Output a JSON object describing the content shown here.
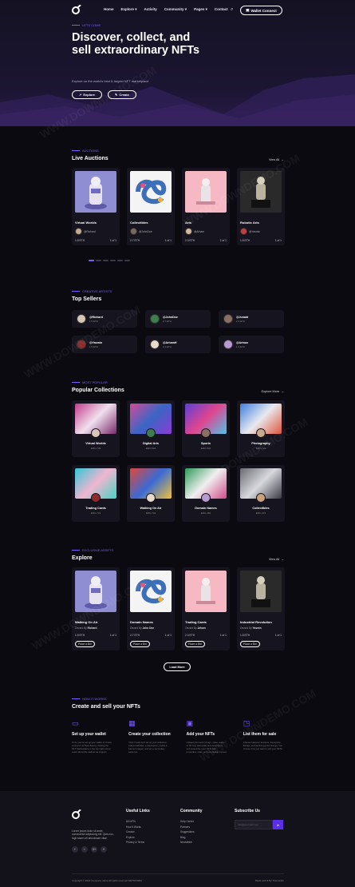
{
  "nav": {
    "items": [
      "Home",
      "Explore ▾",
      "Activity",
      "Community ▾",
      "Pages ▾",
      "Contact"
    ],
    "wallet_label": "Wallet Connect"
  },
  "hero": {
    "eyebrow": "LETS COME",
    "title": "Discover, collect, and sell extraordinary NFTs",
    "subtitle": "Explore on the world's best & largest NFT marketplace",
    "explore_label": "Explore",
    "create_label": "Create"
  },
  "auctions": {
    "eyebrow": "AUCTIONS",
    "title": "Live Auctions",
    "view_all": "View All",
    "items": [
      {
        "name": "Virtual Worlds",
        "owner": "@Richard",
        "price": "1.5 ETH",
        "count": "1 of 1"
      },
      {
        "name": "Collectibles",
        "owner": "@JohnDoe",
        "price": "2.7 ETH",
        "count": "1 of 1"
      },
      {
        "name": "Arts",
        "owner": "@Arham",
        "price": "2.3 ETH",
        "count": "1 of 1"
      },
      {
        "name": "Robotic Arts",
        "owner": "@Yasmin",
        "price": "1.5 ETH",
        "count": "1 of 1"
      }
    ]
  },
  "sellers": {
    "eyebrow": "CREATIVE ARTISTS",
    "title": "Top Sellers",
    "items": [
      {
        "name": "@Richard",
        "eth": "1.5 ETH"
      },
      {
        "name": "@JohnDoe",
        "eth": "2.7 ETH"
      },
      {
        "name": "@Junaid",
        "eth": "2.3 ETH"
      },
      {
        "name": "@Yasmin",
        "eth": "1.5 ETH"
      },
      {
        "name": "@ArhamH",
        "eth": "3.1 ETH"
      },
      {
        "name": "@Artnox",
        "eth": "1.9 ETH"
      }
    ]
  },
  "collections": {
    "eyebrow": "MOST POPULAR",
    "title": "Popular Collections",
    "view_all": "Explore More",
    "items": [
      {
        "name": "Virtual Worlds",
        "info": "ERC-729"
      },
      {
        "name": "Digital Arts",
        "info": "ERC-522"
      },
      {
        "name": "Sports",
        "info": "ERC-534"
      },
      {
        "name": "Photography",
        "info": "ERC-721"
      },
      {
        "name": "Trading Cards",
        "info": "ERC-721"
      },
      {
        "name": "Walking On Air",
        "info": "ERC-722"
      },
      {
        "name": "Domain Names",
        "info": "ERC-482"
      },
      {
        "name": "Collectibles",
        "info": "ERC-472"
      }
    ]
  },
  "explore": {
    "eyebrow": "EXCLUSIVE ASSETS",
    "title": "Explore",
    "view_all": "View All",
    "bid_label": "Place a Bid",
    "load_more": "Load More",
    "items": [
      {
        "name": "Walking On Air",
        "by": "Richard",
        "price": "1.5 ETH",
        "count": "1 of 1"
      },
      {
        "name": "Domain Names",
        "by": "John Doe",
        "price": "2.7 ETH",
        "count": "1 of 1"
      },
      {
        "name": "Trading Cards",
        "by": "Arham",
        "price": "2.3 ETH",
        "count": "1 of 1"
      },
      {
        "name": "Industrial Revolution",
        "by": "Yasmin",
        "price": "1.5 ETH",
        "count": "1 of 1"
      }
    ]
  },
  "how": {
    "eyebrow": "HOW IT WORKS",
    "title": "Create and sell your NFTs",
    "steps": [
      {
        "title": "Set up your wallet",
        "desc": "Once you've set up your wallet of choice, connect it to OpenSea by clicking the NFT Marketplace in the top right corner. Learn about the wallets we support."
      },
      {
        "title": "Create your collection",
        "desc": "Click Create and set up your collection. Add social links, a description, profile & banner images, and set a secondary sales fee."
      },
      {
        "title": "Add your NFTs",
        "desc": "Upload your work (image, video, audio, or 3D art), add a title and description, and customize your NFTs with properties, stats, and unlockable content."
      },
      {
        "title": "List them for sale",
        "desc": "Choose between auctions, fixed-price listings, and declining-price listings. You choose how you want to sell your NFTs!"
      }
    ]
  },
  "footer": {
    "about": "Lorem ipsum dolor sit amet, consectetur adipisicing elit. Quis non, fugit totam vel laboriosam vitae.",
    "social": [
      "f",
      "t",
      "G+",
      "V"
    ],
    "useful_title": "Useful Links",
    "useful_links": [
      "All NFTs",
      "How It Works",
      "Creator",
      "Explore",
      "Privacy & Terms"
    ],
    "community_title": "Community",
    "community_links": [
      "Help Center",
      "Partners",
      "Suggestions",
      "Blog",
      "Newsletter"
    ],
    "subscribe_title": "Subscribe Us",
    "subscribe_placeholder": "Info@yourmail.com",
    "copyright": "Copyright © 2022 Company name All rights reserved NETSTORM",
    "made_with": "Made with ♥ By ThemeHim"
  },
  "watermark": "WWW.DOWNDEMO.COM",
  "colors": {
    "accent": "#7b5cff",
    "background": "#0b0a10",
    "card": "#16151f"
  }
}
